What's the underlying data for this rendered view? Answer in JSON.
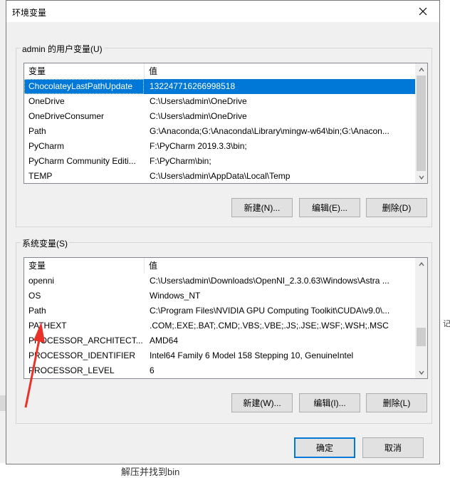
{
  "background": {
    "bottom_text": "解压并找到bin",
    "side_glyph": "记"
  },
  "dialog": {
    "title": "环境变量"
  },
  "user_vars": {
    "group_label": "admin 的用户变量(U)",
    "columns": [
      "变量",
      "值"
    ],
    "rows": [
      {
        "name": "ChocolateyLastPathUpdate",
        "value": "132247716266998518",
        "selected": true
      },
      {
        "name": "OneDrive",
        "value": "C:\\Users\\admin\\OneDrive"
      },
      {
        "name": "OneDriveConsumer",
        "value": "C:\\Users\\admin\\OneDrive"
      },
      {
        "name": "Path",
        "value": "G:\\Anaconda;G:\\Anaconda\\Library\\mingw-w64\\bin;G:\\Anacon..."
      },
      {
        "name": "PyCharm",
        "value": "F:\\PyCharm 2019.3.3\\bin;"
      },
      {
        "name": "PyCharm Community Editi...",
        "value": "F:\\PyCharm\\bin;"
      },
      {
        "name": "TEMP",
        "value": "C:\\Users\\admin\\AppData\\Local\\Temp"
      }
    ],
    "buttons": {
      "new": "新建(N)...",
      "edit": "编辑(E)...",
      "delete": "删除(D)"
    }
  },
  "system_vars": {
    "group_label": "系统变量(S)",
    "columns": [
      "变量",
      "值"
    ],
    "rows": [
      {
        "name": "openni",
        "value": "C:\\Users\\admin\\Downloads\\OpenNI_2.3.0.63\\Windows\\Astra ..."
      },
      {
        "name": "OS",
        "value": "Windows_NT"
      },
      {
        "name": "Path",
        "value": "C:\\Program Files\\NVIDIA GPU Computing Toolkit\\CUDA\\v9.0\\..."
      },
      {
        "name": "PATHEXT",
        "value": ".COM;.EXE;.BAT;.CMD;.VBS;.VBE;.JS;.JSE;.WSF;.WSH;.MSC"
      },
      {
        "name": "PROCESSOR_ARCHITECT...",
        "value": "AMD64"
      },
      {
        "name": "PROCESSOR_IDENTIFIER",
        "value": "Intel64 Family 6 Model 158 Stepping 10, GenuineIntel"
      },
      {
        "name": "PROCESSOR_LEVEL",
        "value": "6"
      }
    ],
    "buttons": {
      "new": "新建(W)...",
      "edit": "编辑(I)...",
      "delete": "删除(L)"
    }
  },
  "footer": {
    "ok": "确定",
    "cancel": "取消"
  },
  "colors": {
    "selection": "#0078d7",
    "annotation_arrow": "#e8322a",
    "default_button_border": "#0078d7"
  },
  "icons": {
    "close": "close-icon",
    "scroll_up": "chevron-up-icon",
    "scroll_down": "chevron-down-icon"
  }
}
